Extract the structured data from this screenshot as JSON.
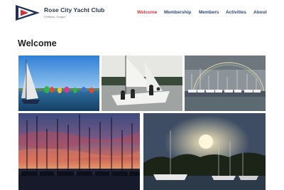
{
  "site": {
    "name": "Rose City Yacht Club",
    "location": "Portland, Oregon",
    "logo_icon": "burgee-flag-icon"
  },
  "nav": {
    "items": [
      {
        "label": "Welcome",
        "active": true
      },
      {
        "label": "Membership",
        "active": false
      },
      {
        "label": "Members",
        "active": false
      },
      {
        "label": "Activities",
        "active": false
      },
      {
        "label": "About",
        "active": false
      }
    ]
  },
  "main": {
    "title": "Welcome"
  },
  "colors": {
    "brand_navy": "#2a3b56",
    "nav_link": "#2d4a7a",
    "nav_active": "#d0343c"
  }
}
